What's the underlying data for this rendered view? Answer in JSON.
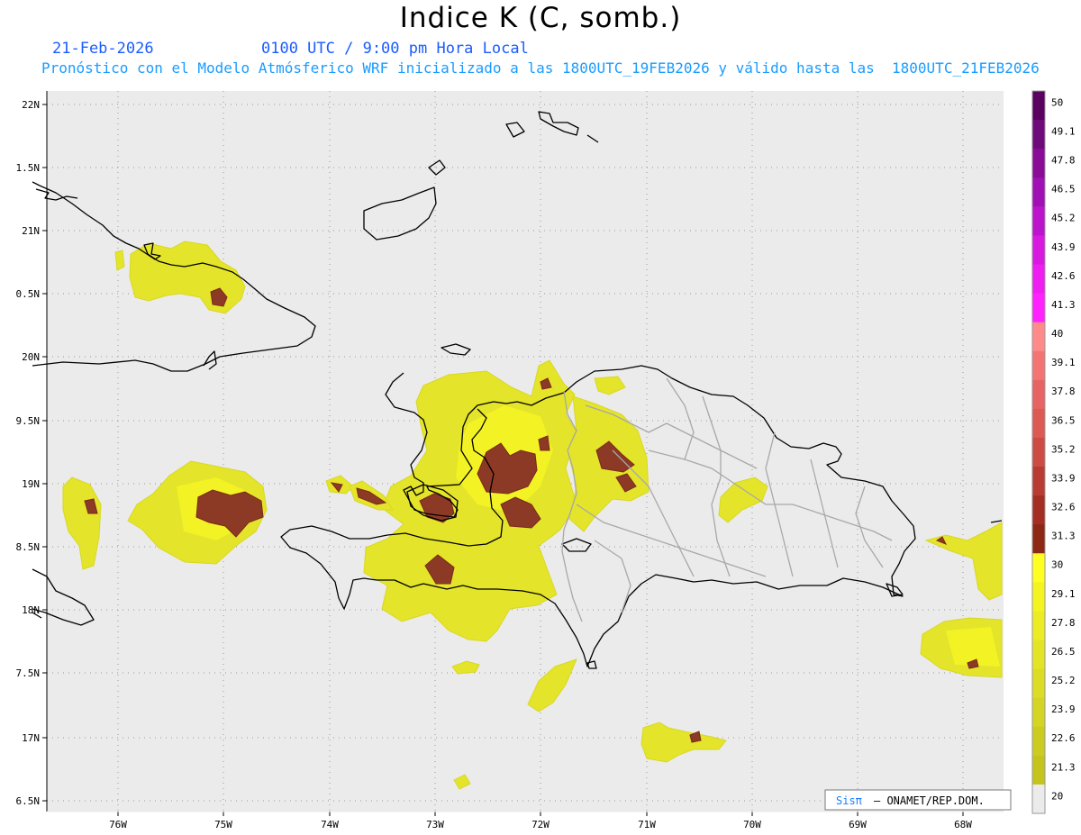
{
  "header": {
    "title": "Indice K (C, somb.)",
    "date": "21-Feb-2026",
    "time": "0100 UTC / 9:00 pm Hora Local",
    "description": "Pronóstico con el Modelo Atmósferico WRF inicializado a las 1800UTC_19FEB2026 y válido hasta las  1800UTC_21FEB2026"
  },
  "map": {
    "lat_labels": [
      "22N",
      "1.5N",
      "21N",
      "0.5N",
      "20N",
      "9.5N",
      "19N",
      "8.5N",
      "18N",
      "7.5N",
      "17N",
      "6.5N"
    ],
    "lon_labels": [
      "76W",
      "75W",
      "74W",
      "73W",
      "72W",
      "71W",
      "70W",
      "69W",
      "68W"
    ],
    "background_color": "#ebebeb",
    "grid": "dotted"
  },
  "colorbar": {
    "levels": [
      "50",
      "49.1",
      "47.8",
      "46.5",
      "45.2",
      "43.9",
      "42.6",
      "41.3",
      "40",
      "39.1",
      "37.8",
      "36.5",
      "35.2",
      "33.9",
      "32.6",
      "31.3",
      "30",
      "29.1",
      "27.8",
      "26.5",
      "25.2",
      "23.9",
      "22.6",
      "21.3",
      "20"
    ],
    "colors": [
      "#5a0060",
      "#6e0a7a",
      "#8a0c96",
      "#a010b4",
      "#bc14cc",
      "#d81ae0",
      "#ee1ef0",
      "#ff22ff",
      "#ff8a8a",
      "#f47474",
      "#e86464",
      "#dc5a52",
      "#cc4c44",
      "#b83c34",
      "#a42e24",
      "#8c2814",
      "#ffff22",
      "#f4f420",
      "#ecec24",
      "#e4e426",
      "#dcdc24",
      "#d4d424",
      "#cccc20",
      "#c4c41c"
    ]
  },
  "credit": {
    "logo": "Sisπ",
    "text": "– ONAMET/REP.DOM."
  }
}
